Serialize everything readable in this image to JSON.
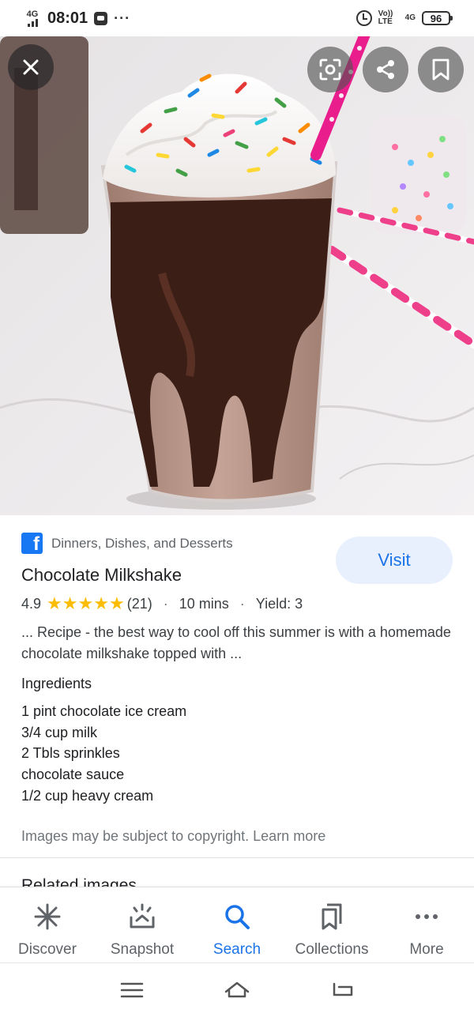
{
  "status_bar": {
    "network": "4G",
    "time": "08:01",
    "more": "···",
    "volte": "Vo)) LTE",
    "network_right": "4G",
    "battery": "96",
    "icons": [
      "signal-icon",
      "message-icon",
      "alarm-icon",
      "battery-icon"
    ]
  },
  "hero": {
    "icons": [
      "close-icon",
      "lens-icon",
      "share-icon",
      "bookmark-icon"
    ]
  },
  "result": {
    "source": "Dinners, Dishes, and Desserts",
    "source_icon": "facebook-icon",
    "visit_label": "Visit",
    "title": "Chocolate Milkshake",
    "rating": "4.9",
    "stars": 5,
    "review_count": "(21)",
    "time": "10 mins",
    "yield": "Yield: 3",
    "separator": "·",
    "snippet": "... Recipe - the best way to cool off this summer is with a homemade chocolate milkshake topped with ...",
    "ingredients_heading": "Ingredients",
    "ingredients": [
      "1 pint chocolate ice cream",
      "3/4 cup milk",
      "2 Tbls sprinkles",
      "chocolate sauce",
      "1/2 cup heavy cream"
    ],
    "copyright": "Images may be subject to copyright.",
    "learn_more": "Learn more",
    "related_heading": "Related images"
  },
  "bottom_nav": {
    "items": [
      {
        "label": "Discover",
        "icon": "asterisk-icon",
        "active": false
      },
      {
        "label": "Snapshot",
        "icon": "snapshot-icon",
        "active": false
      },
      {
        "label": "Search",
        "icon": "search-icon",
        "active": true
      },
      {
        "label": "Collections",
        "icon": "collections-icon",
        "active": false
      },
      {
        "label": "More",
        "icon": "more-icon",
        "active": false
      }
    ],
    "active_color": "#1a73e8"
  },
  "system_nav": {
    "icons": [
      "menu-icon",
      "home-icon",
      "back-icon"
    ]
  }
}
